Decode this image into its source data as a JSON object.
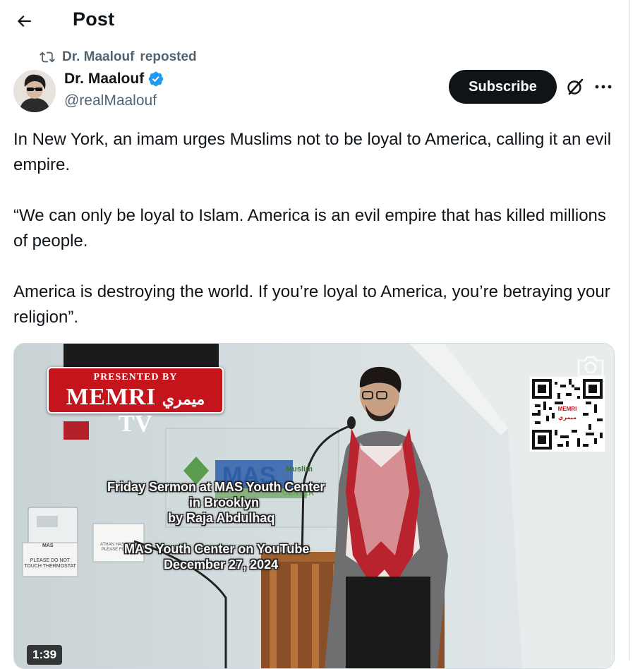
{
  "header": {
    "title": "Post",
    "back_icon": "arrow-left-icon"
  },
  "repost": {
    "icon": "repost-icon",
    "reposter_name": "Dr. Maalouf",
    "action": "reposted"
  },
  "author": {
    "display_name": "Dr. Maalouf",
    "verified": true,
    "verified_color": "#1d9bf0",
    "handle": "@realMaalouf",
    "avatar_icon": "avatar"
  },
  "actions": {
    "subscribe_label": "Subscribe",
    "grok_icon": "grok-icon",
    "more_icon": "more-icon"
  },
  "post": {
    "paragraphs": [
      "In New York, an imam urges Muslims not to be loyal to America, calling it an evil empire.",
      "“We can only be loyal to Islam. America is an evil empire that has killed millions of people.",
      "America is destroying the world. If you’re loyal to America, you’re betraying your religion”."
    ]
  },
  "video": {
    "logo_presented": "PRESENTED BY",
    "logo_memri": "MEMRI",
    "logo_arabic": "ميمري",
    "logo_tv": "TV",
    "caption_line1": "Friday Sermon at MAS Youth Center",
    "caption_line2": "in Brooklyn",
    "caption_line3": "by Raja Abdulhaq",
    "source_line1": "MAS Youth Center on YouTube",
    "source_line2": "December 27, 2024",
    "wall_sign_main": "MAS",
    "wall_sign_small": "Muslim",
    "wall_sign_center": "CENTER",
    "thermostat_sign": "PLEASE DO NOT TOUCH THERMOSTAT",
    "thermostat_sign_mas": "MAS",
    "athan_sign": "ATHAN HAS BEEN PLEASE FOR MA",
    "qr_label_en": "MEMRI",
    "qr_label_ar": "ميمري",
    "duration": "1:39",
    "camera_icon": "camera-icon",
    "brand_red": "#c4151d"
  },
  "colors": {
    "text_primary": "#0f1419",
    "text_secondary": "#536471",
    "subscribe_bg": "#0f1419",
    "verified_blue": "#1d9bf0"
  }
}
